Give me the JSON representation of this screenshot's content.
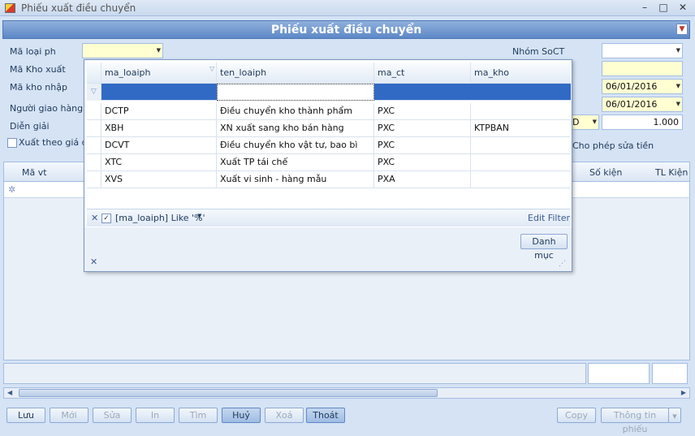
{
  "window": {
    "title": "Phiếu xuất điều chuyển"
  },
  "window_controls": {
    "minimize": "–",
    "maximize": "□",
    "close": "✕"
  },
  "header": {
    "title": "Phiếu xuất điều chuyển"
  },
  "form": {
    "ma_loai_ph": "Mã loại ph",
    "ma_kho_xuat": "Mã Kho xuất",
    "ma_kho_nhap": "Mã kho nhập",
    "nguoi_giao_hang": "Người giao hàng",
    "dien_giai": "Diễn giải",
    "xuat_theo_gia": "Xuất theo giá đíc",
    "nhom_soct": "Nhóm SoCT",
    "date1": "06/01/2016",
    "date2": "06/01/2016",
    "currency_code": "D",
    "rate": "1.000",
    "cho_phep_sua_tien": "Cho phép sửa tiền"
  },
  "grid": {
    "col_ma_vt": "Mã vt",
    "col_so_kien": "Số kiện",
    "col_tl_kien": "TL Kiện"
  },
  "popup": {
    "columns": [
      "ma_loaiph",
      "ten_loaiph",
      "ma_ct",
      "ma_kho"
    ],
    "rows": [
      [
        "DCTP",
        "Điều chuyển kho thành phẩm",
        "PXC",
        ""
      ],
      [
        "XBH",
        "XN xuất sang kho bán hàng",
        "PXC",
        "KTPBAN"
      ],
      [
        "DCVT",
        "Điều chuyển kho vật tư, bao bì",
        "PXC",
        ""
      ],
      [
        "XTC",
        "Xuất TP tái chế",
        "PXC",
        ""
      ],
      [
        "XVS",
        "Xuất vi sinh - hàng mẫu",
        "PXA",
        ""
      ]
    ],
    "filter_text": "[ma_loaiph] Like '%'",
    "edit_filter": "Edit Filter",
    "danh_muc": "Danh mục"
  },
  "toolbar": {
    "luu": "Lưu",
    "moi": "Mới",
    "sua": "Sửa",
    "in": "In",
    "tim": "Tìm",
    "huy": "Huỷ",
    "xoa": "Xoá",
    "thoat": "Thoát",
    "copy": "Copy",
    "thong_tin_phieu": "Thông tin phiếu"
  }
}
